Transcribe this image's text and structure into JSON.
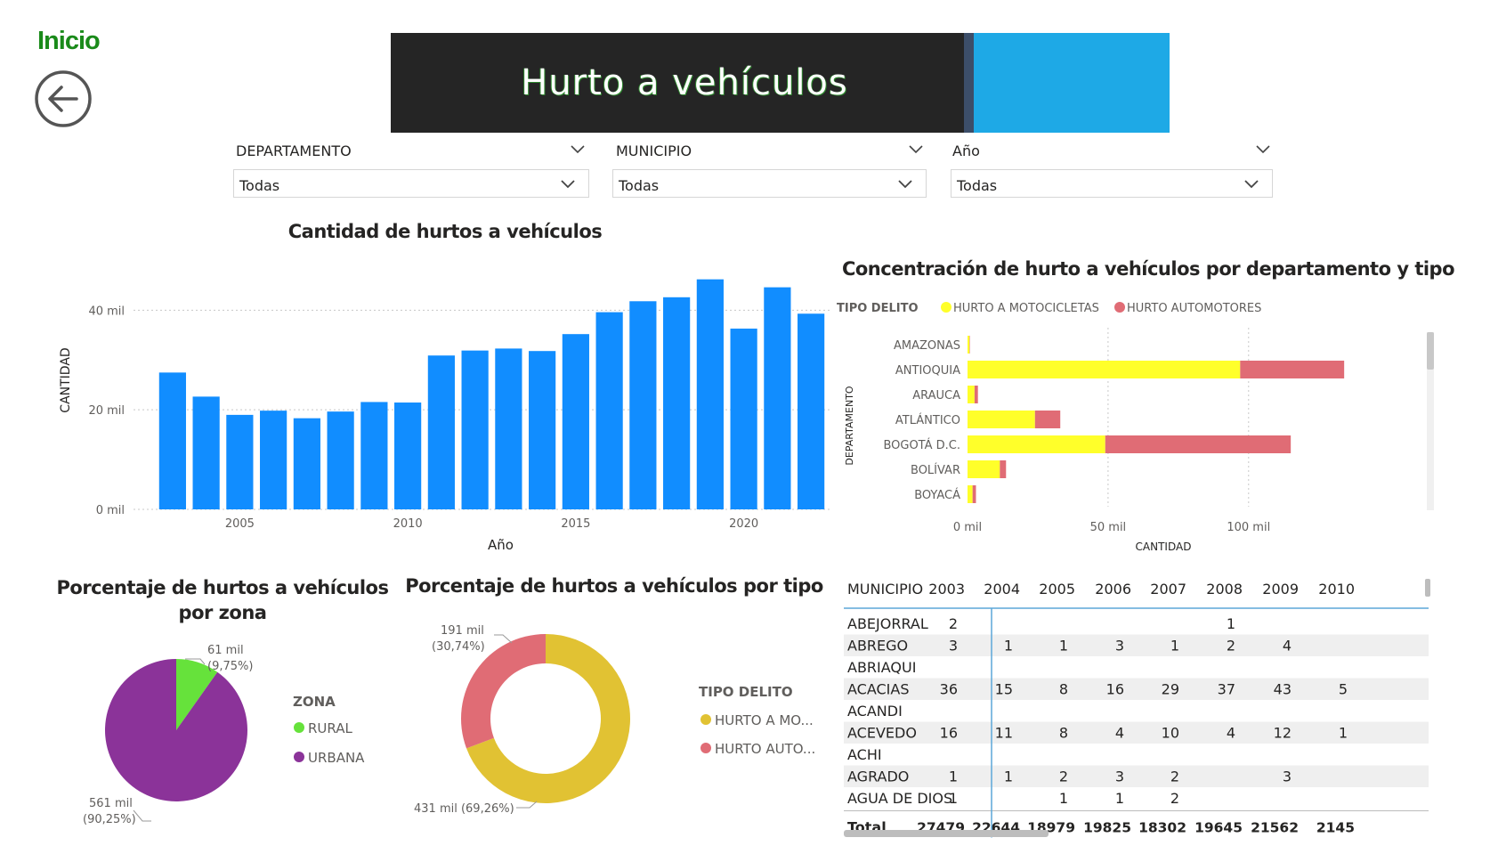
{
  "nav": {
    "home_label": "Inicio"
  },
  "header": {
    "title": "Hurto a vehículos"
  },
  "filters": [
    {
      "label": "DEPARTAMENTO",
      "value": "Todas"
    },
    {
      "label": "MUNICIPIO",
      "value": "Todas"
    },
    {
      "label": "Año",
      "value": "Todas"
    }
  ],
  "colors": {
    "bar_blue": "#118dff",
    "motos_yellow": "#ffff2a",
    "autos_red": "#e06c75",
    "rural_green": "#66e23b",
    "urbana_purple": "#8b3399",
    "donut_yellow": "#e1c233",
    "donut_red": "#e06c75",
    "title_blue": "#1ea9e6"
  },
  "chart_data": [
    {
      "id": "yearly",
      "type": "bar",
      "title": "Cantidad de hurtos a vehículos",
      "xlabel": "Año",
      "ylabel": "CANTIDAD",
      "x": [
        2003,
        2004,
        2005,
        2006,
        2007,
        2008,
        2009,
        2010,
        2011,
        2012,
        2013,
        2014,
        2015,
        2016,
        2017,
        2018,
        2019,
        2020,
        2021,
        2022
      ],
      "values": [
        27479,
        22644,
        18979,
        19825,
        18302,
        19645,
        21562,
        21457,
        30900,
        31900,
        32300,
        31800,
        35200,
        39600,
        41800,
        42600,
        46200,
        36300,
        44600,
        39300
      ],
      "x_ticks": [
        2005,
        2010,
        2015,
        2020
      ],
      "y_ticks": [
        0,
        20000,
        40000
      ],
      "y_tick_labels": [
        "0 mil",
        "20 mil",
        "40 mil"
      ],
      "ylim": [
        0,
        46500
      ]
    },
    {
      "id": "dept",
      "type": "bar",
      "orientation": "horizontal",
      "stacked": true,
      "title": "Concentración de hurto a vehículos por departamento y tipo",
      "legend_title": "TIPO DELITO",
      "xlabel": "CANTIDAD",
      "ylabel": "DEPARTAMENTO",
      "categories": [
        "AMAZONAS",
        "ANTIOQUIA",
        "ARAUCA",
        "ATLÁNTICO",
        "BOGOTÁ D.C.",
        "BOLÍVAR",
        "BOYACÁ"
      ],
      "series": [
        {
          "name": "HURTO A MOTOCICLETAS",
          "values": [
            700,
            97000,
            2500,
            24000,
            49000,
            11500,
            1800
          ]
        },
        {
          "name": "HURTO AUTOMOTORES",
          "values": [
            150,
            37000,
            1200,
            9000,
            66000,
            2200,
            1200
          ]
        }
      ],
      "x_ticks": [
        0,
        50000,
        100000
      ],
      "x_tick_labels": [
        "0 mil",
        "50 mil",
        "100 mil"
      ],
      "xlim": [
        0,
        152000
      ]
    },
    {
      "id": "zona",
      "type": "pie",
      "title": "Porcentaje de hurtos a vehículos por zona",
      "legend_title": "ZONA",
      "slices": [
        {
          "name": "RURAL",
          "value": 61,
          "label_value": "61 mil",
          "label_pct": "(9,75%)"
        },
        {
          "name": "URBANA",
          "value": 561,
          "label_value": "561 mil",
          "label_pct": "(90,25%)"
        }
      ]
    },
    {
      "id": "tipo",
      "type": "pie",
      "donut": true,
      "title": "Porcentaje de hurtos a vehículos por tipo",
      "legend_title": "TIPO DELITO",
      "slices": [
        {
          "name": "HURTO A MO...",
          "value": 431,
          "label": "431 mil (69,26%)"
        },
        {
          "name": "HURTO AUTO...",
          "value": 191,
          "label_value": "191 mil",
          "label_pct": "(30,74%)"
        }
      ]
    }
  ],
  "matrix": {
    "row_header": "MUNICIPIO",
    "columns": [
      "2003",
      "2004",
      "2005",
      "2006",
      "2007",
      "2008",
      "2009",
      "2010"
    ],
    "rows": [
      {
        "name": "ABEJORRAL",
        "cells": [
          "2",
          "",
          "",
          "",
          "",
          "1",
          "",
          ""
        ]
      },
      {
        "name": "ABREGO",
        "cells": [
          "3",
          "1",
          "1",
          "3",
          "1",
          "2",
          "4",
          ""
        ]
      },
      {
        "name": "ABRIAQUI",
        "cells": [
          "",
          "",
          "",
          "",
          "",
          "",
          "",
          ""
        ]
      },
      {
        "name": "ACACIAS",
        "cells": [
          "36",
          "15",
          "8",
          "16",
          "29",
          "37",
          "43",
          "5"
        ]
      },
      {
        "name": "ACANDI",
        "cells": [
          "",
          "",
          "",
          "",
          "",
          "",
          "",
          ""
        ]
      },
      {
        "name": "ACEVEDO",
        "cells": [
          "16",
          "11",
          "8",
          "4",
          "10",
          "4",
          "12",
          "1"
        ]
      },
      {
        "name": "ACHI",
        "cells": [
          "",
          "",
          "",
          "",
          "",
          "",
          "",
          ""
        ]
      },
      {
        "name": "AGRADO",
        "cells": [
          "1",
          "1",
          "2",
          "3",
          "2",
          "",
          "3",
          ""
        ]
      },
      {
        "name": "AGUA DE DIOS",
        "cells": [
          "1",
          "",
          "1",
          "1",
          "2",
          "",
          "",
          ""
        ]
      }
    ],
    "total_label": "Total",
    "totals": [
      "27479",
      "22644",
      "18979",
      "19825",
      "18302",
      "19645",
      "21562",
      "2145"
    ]
  }
}
